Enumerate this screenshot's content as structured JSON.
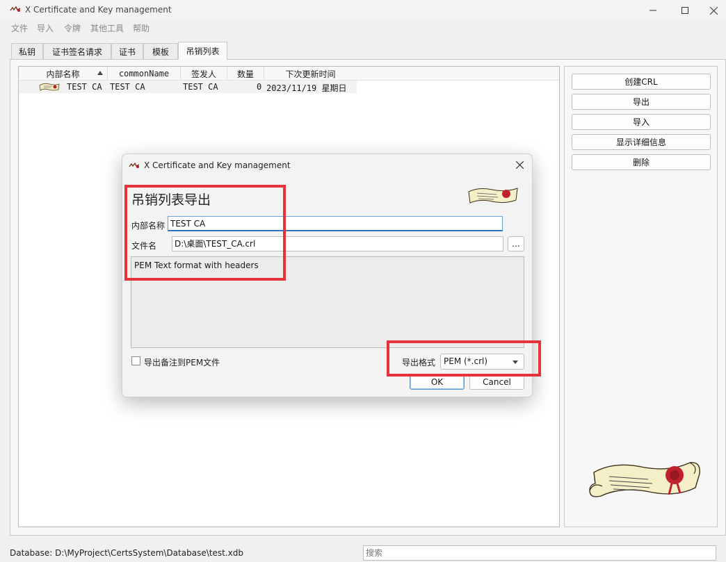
{
  "window": {
    "title": "X Certificate and Key management"
  },
  "menu": [
    "文件",
    "导入",
    "令牌",
    "其他工具",
    "帮助"
  ],
  "tabs": [
    "私钥",
    "证书签名请求",
    "证书",
    "模板",
    "吊销列表"
  ],
  "active_tab": "吊销列表",
  "list": {
    "columns": [
      "内部名称",
      "commonName",
      "签发人",
      "数量",
      "下次更新时间"
    ],
    "rows": [
      {
        "internal_name": "TEST CA",
        "common_name": "TEST CA",
        "issuer": "TEST CA",
        "count": "0",
        "next_update": "2023/11/19 星期日"
      }
    ]
  },
  "side_buttons": [
    "创建CRL",
    "导出",
    "导入",
    "显示详细信息",
    "删除"
  ],
  "status": {
    "database": "Database: D:\\MyProject\\CertsSystem\\Database\\test.xdb",
    "search_placeholder": "搜索"
  },
  "dialog": {
    "title": "X Certificate and Key management",
    "heading": "吊销列表导出",
    "internal_name_label": "内部名称",
    "internal_name_value": "TEST CA",
    "filename_label": "文件名",
    "filename_value": "D:\\桌面\\TEST_CA.crl",
    "browse_label": "...",
    "description": "PEM Text format with headers",
    "checkbox_label": "导出备注到PEM文件",
    "format_label": "导出格式",
    "format_value": "PEM (*.crl)",
    "ok_label": "OK",
    "cancel_label": "Cancel"
  },
  "colors": {
    "highlight": "#e5323b",
    "focus": "#2a72c1"
  }
}
